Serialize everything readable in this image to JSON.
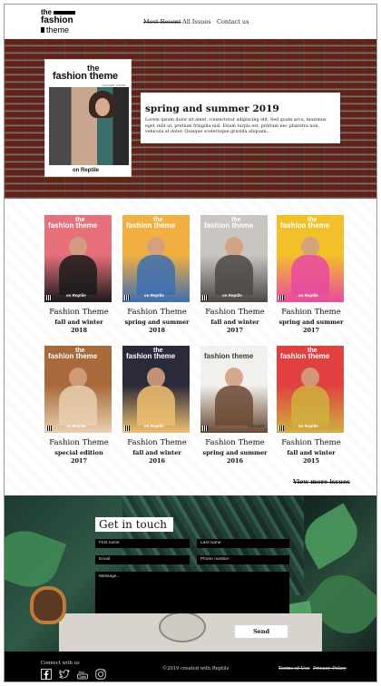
{
  "header": {
    "logo": {
      "line1": "the",
      "line2": "fashion",
      "line3": "theme"
    },
    "nav": [
      {
        "label": "Most Recent",
        "active": true
      },
      {
        "label": "All Issues",
        "active": false
      },
      {
        "label": "Contact us",
        "active": false
      }
    ]
  },
  "hero": {
    "cover": {
      "the": "the",
      "title": "fashion theme",
      "copyright": "copyright ©2019",
      "publisher": "on Reptile"
    },
    "issue_title": "spring and summer 2019",
    "description": "Lorem ipsum dolor sit amet, consectetur adipiscing elit. Sed quam arcu, maximus eget velit ut, pretium fringilla nisl. Etiam turpis est, pretium nec pharetra non, vehicula at dolor. Quisque scelerisque gravida aliquam…"
  },
  "issues": [
    {
      "name": "Fashion Theme",
      "season": "fall and winter",
      "year": "2018",
      "cover_title": "fashion theme",
      "cover_the": "the",
      "cover_publisher": "on Reptile",
      "colors": [
        "#e8707a",
        "#1b1b1b"
      ]
    },
    {
      "name": "Fashion Theme",
      "season": "spring and summer",
      "year": "2018",
      "cover_title": "fashion theme",
      "cover_the": "the",
      "cover_publisher": "on Reptile",
      "colors": [
        "#f2b040",
        "#3d6fb0"
      ]
    },
    {
      "name": "Fashion Theme",
      "season": "fall and winter",
      "year": "2017",
      "cover_title": "fashion theme",
      "cover_the": "the",
      "cover_publisher": "on Reptile",
      "colors": [
        "#c9c6c2",
        "#4b4846"
      ]
    },
    {
      "name": "Fashion Theme",
      "season": "spring and summer",
      "year": "2017",
      "cover_title": "fashion theme",
      "cover_the": "the",
      "cover_publisher": "on Reptile",
      "colors": [
        "#f2c12a",
        "#e84aa0"
      ]
    },
    {
      "name": "Fashion Theme",
      "season": "special edition",
      "year": "2017",
      "cover_title": "fashion theme",
      "cover_the": "the",
      "cover_publisher": "on Reptile",
      "colors": [
        "#a86a3a",
        "#e8d0b0"
      ]
    },
    {
      "name": "Fashion Theme",
      "season": "fall and winter",
      "year": "2016",
      "cover_title": "fashion theme",
      "cover_the": "the",
      "cover_publisher": "on Reptile",
      "colors": [
        "#2b2a3a",
        "#f0c070"
      ]
    },
    {
      "name": "Fashion Theme",
      "season": "spring and summer",
      "year": "2016",
      "cover_title": "fashion theme",
      "cover_the": "the",
      "cover_publisher": "",
      "cover_copyright": "copyright",
      "colors": [
        "#f2f0ec",
        "#6b4a34"
      ]
    },
    {
      "name": "Fashion Theme",
      "season": "fall and winter",
      "year": "2015",
      "cover_title": "fashion theme",
      "cover_the": "the",
      "cover_publisher": "on Reptile",
      "colors": [
        "#e04040",
        "#d0b040"
      ]
    }
  ],
  "view_more": "View more issues",
  "contact": {
    "heading": "Get in touch",
    "first_name": "First name",
    "last_name": "Last name",
    "email": "Email",
    "phone": "Phone number",
    "message": "Message...",
    "send": "Send"
  },
  "footer": {
    "connect": "Connect with us",
    "icons": [
      "facebook-icon",
      "twitter-icon",
      "youtube-icon",
      "instagram-icon"
    ],
    "copyright": "©2019 created with Reptile",
    "terms": "Terms of Use",
    "privacy": "Privacy Policy"
  }
}
